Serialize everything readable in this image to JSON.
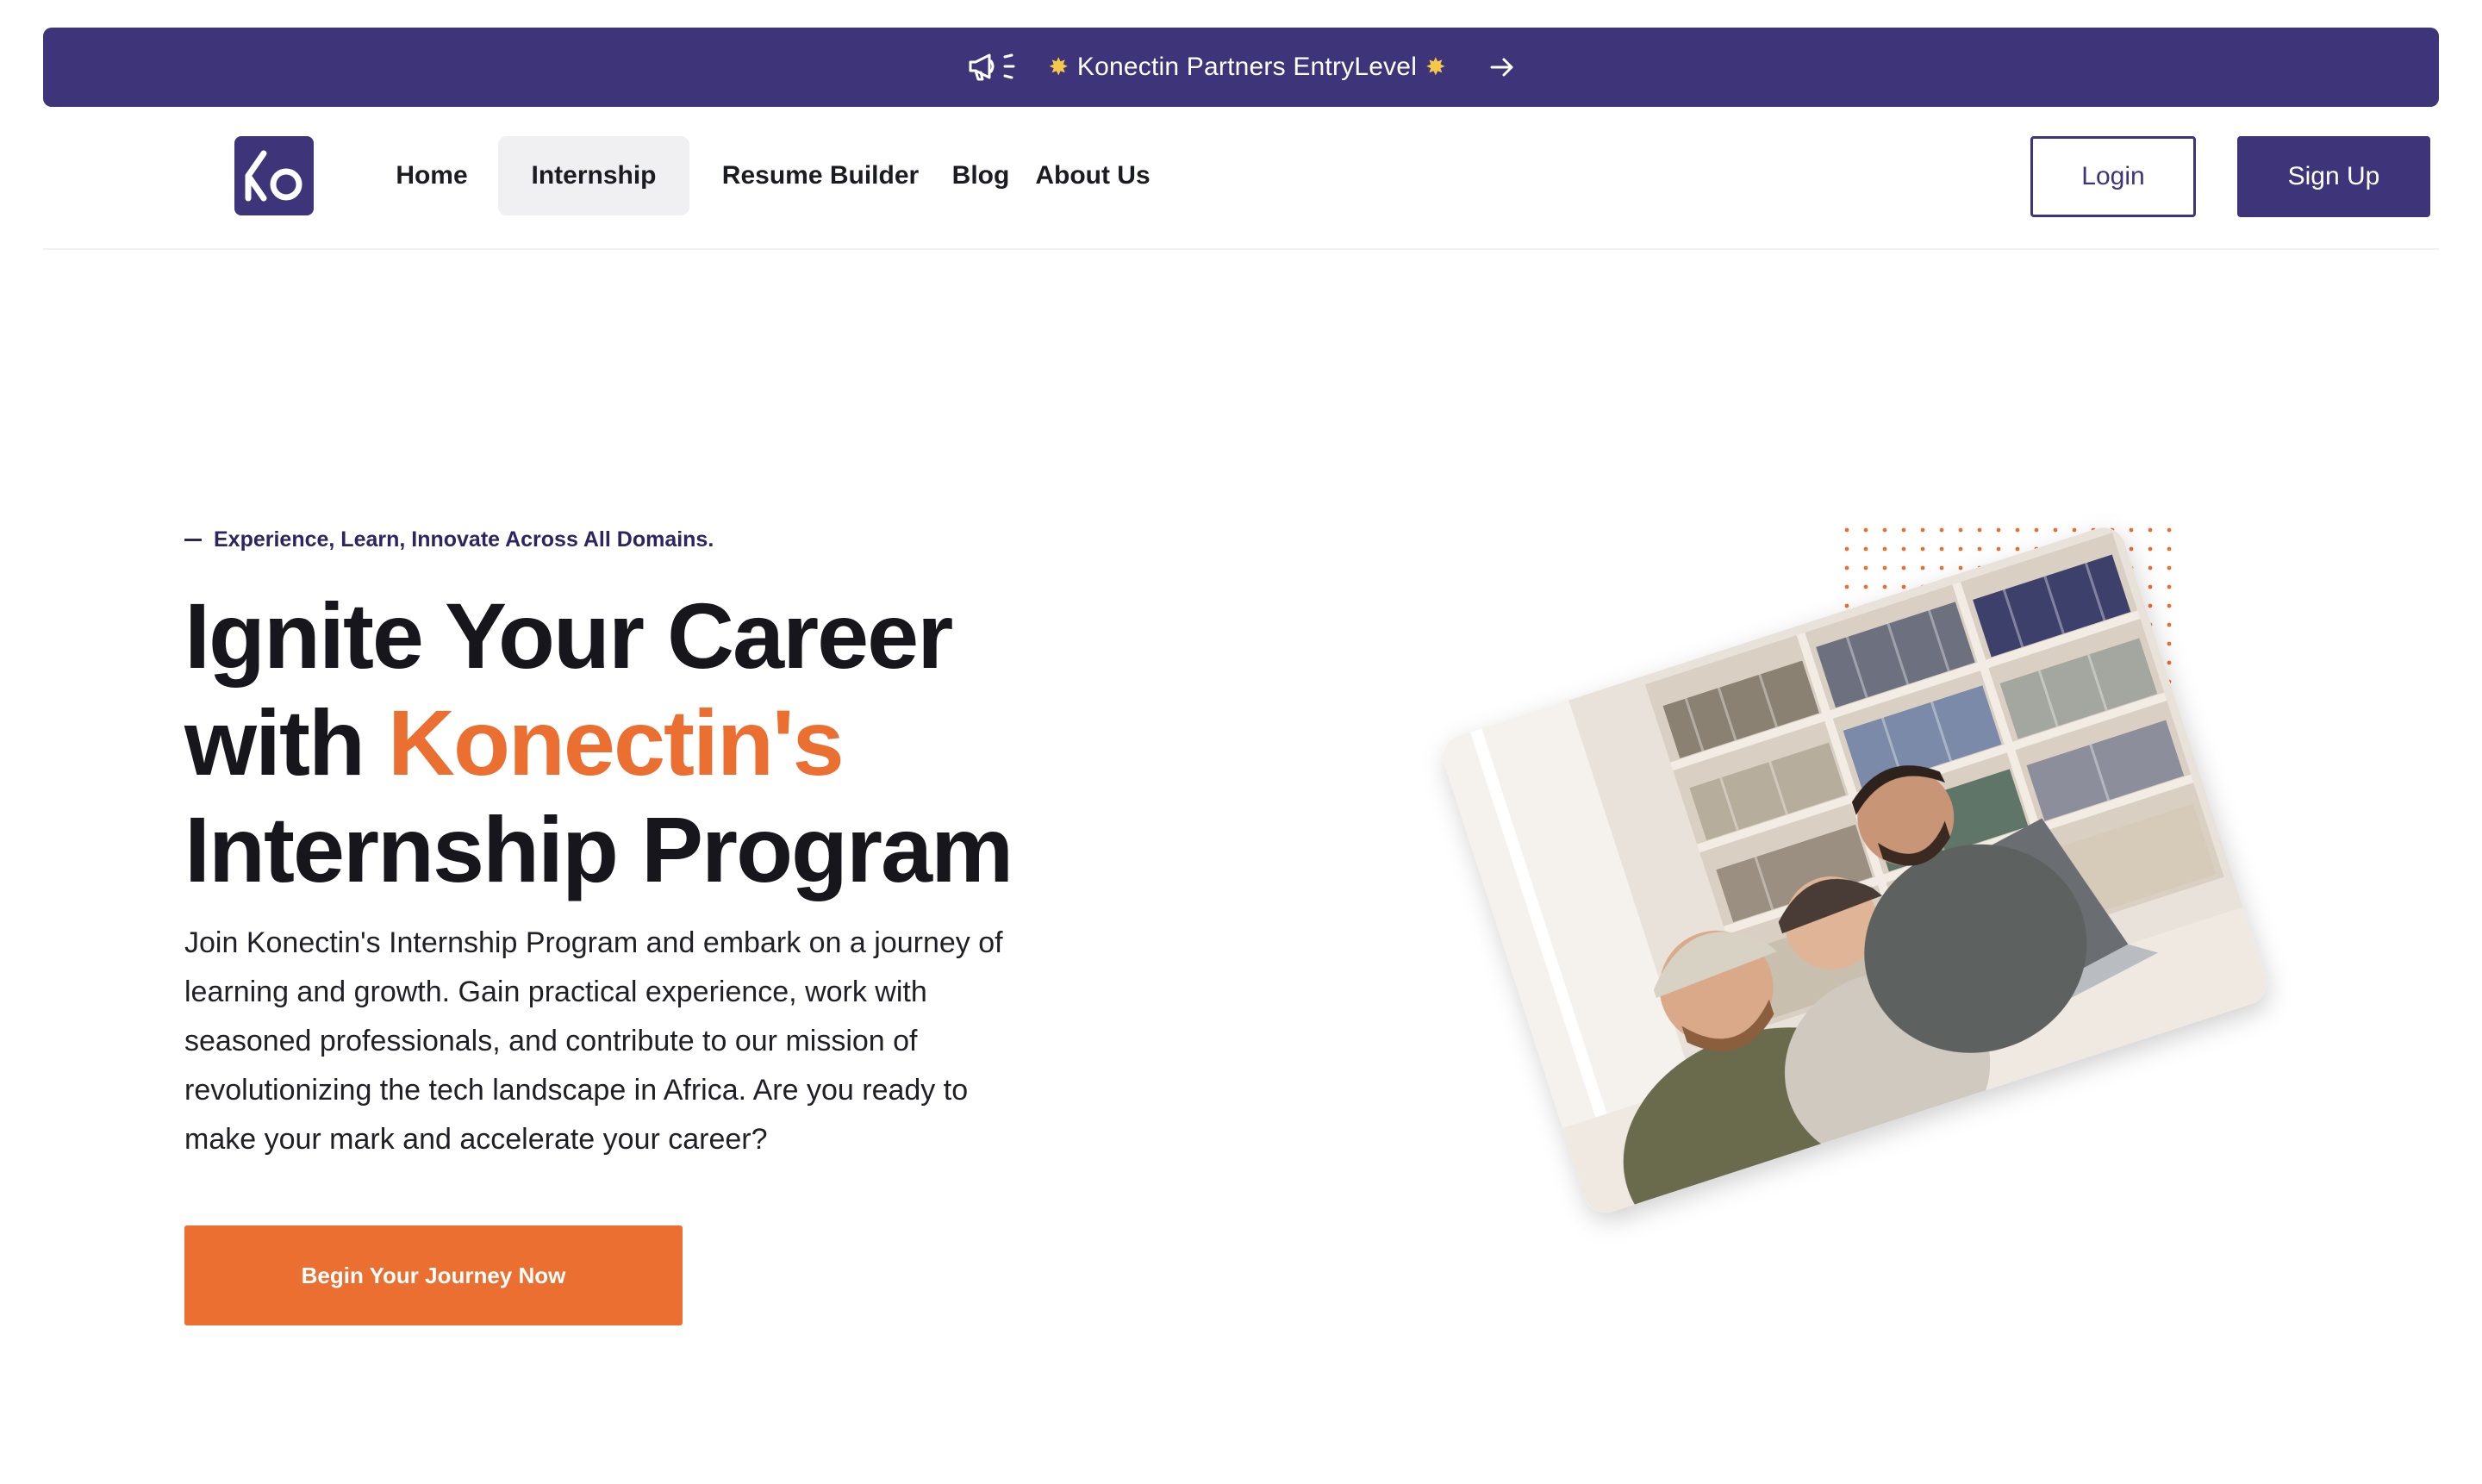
{
  "announcement": {
    "icon": "megaphone-icon",
    "text": "Konectin Partners EntryLevel",
    "star_icon": "sparkle-star-icon",
    "arrow_icon": "arrow-right-icon"
  },
  "nav": {
    "logo": "Konectin logo",
    "items": [
      {
        "label": "Home",
        "active": false
      },
      {
        "label": "Internship",
        "active": true
      },
      {
        "label": "Resume Builder",
        "active": false
      },
      {
        "label": "Blog",
        "active": false
      },
      {
        "label": "About Us",
        "active": false
      }
    ],
    "login_label": "Login",
    "signup_label": "Sign Up"
  },
  "hero": {
    "eyebrow": "Experience, Learn, Innovate Across All Domains.",
    "title_line1": "Ignite Your Career",
    "title_line2_prefix": "with ",
    "title_line2_accent": "Konectin's",
    "title_line3": "Internship Program",
    "description": "Join Konectin's Internship Program and embark on a journey of learning and growth. Gain practical experience, work with seasoned professionals, and contribute to our mission of revolutionizing the tech landscape in Africa. Are you ready to make your mark and accelerate your career?",
    "cta_label": "Begin Your Journey Now",
    "image_alt": "Students laughing together at laptops in a library"
  },
  "colors": {
    "brand": "#3e3479",
    "accent": "#ea6f31",
    "text": "#16161c"
  }
}
